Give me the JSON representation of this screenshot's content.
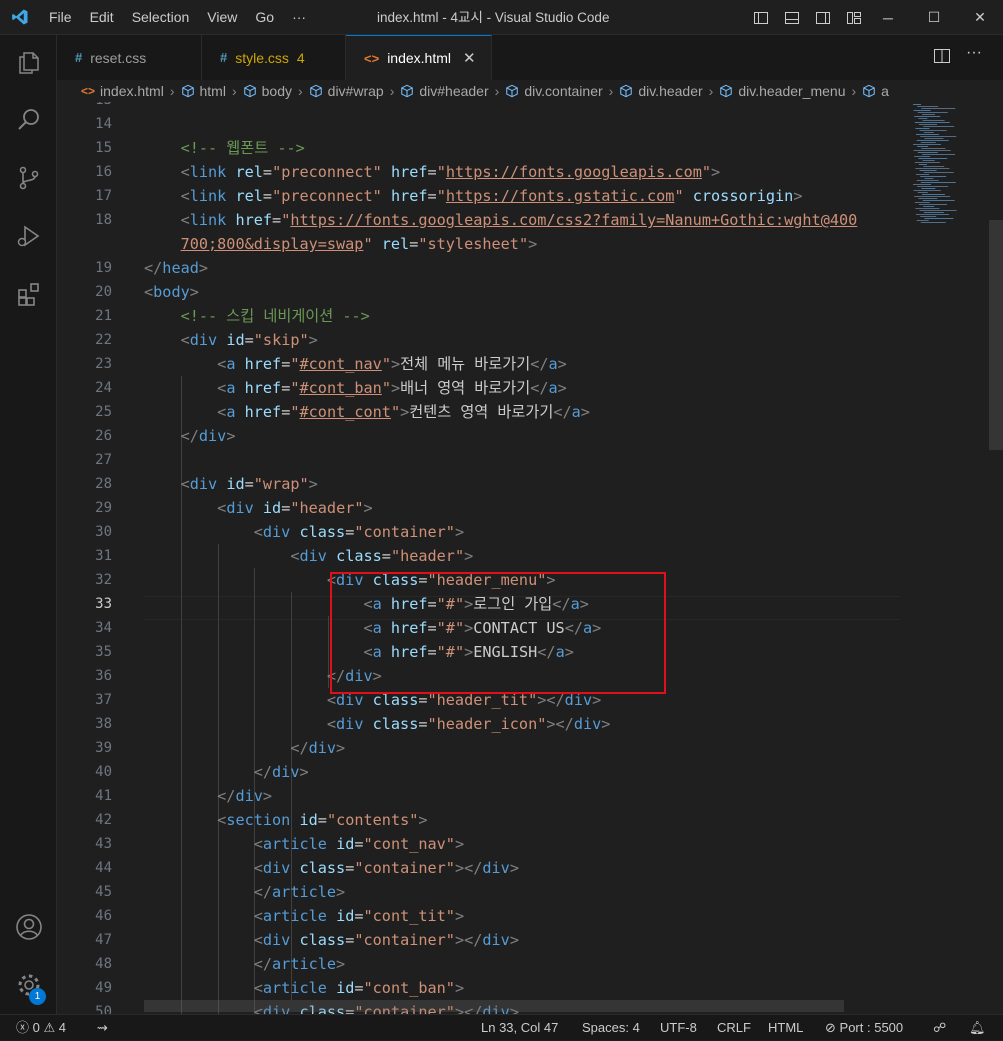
{
  "titlebar": {
    "menu": [
      "File",
      "Edit",
      "Selection",
      "View",
      "Go",
      "···"
    ],
    "title": "index.html - 4교시 - Visual Studio Code"
  },
  "tabs": [
    {
      "label": "reset.css",
      "icon": "css-hash-icon",
      "modified_count": ""
    },
    {
      "label": "style.css",
      "icon": "css-hash-icon",
      "modified_count": "4"
    },
    {
      "label": "index.html",
      "icon": "html-icon",
      "modified_count": ""
    }
  ],
  "breadcrumb": [
    "index.html",
    "html",
    "body",
    "div#wrap",
    "div#header",
    "div.container",
    "div.header",
    "div.header_menu",
    "a"
  ],
  "editor": {
    "current_line": 33,
    "lines": [
      {
        "n": "13",
        "html": ""
      },
      {
        "n": "14",
        "html": ""
      },
      {
        "n": "15",
        "html": "    <span class=\"c\">&lt;!-- 웹폰트 --&gt;</span>"
      },
      {
        "n": "16",
        "html": "    <span class=\"p\">&lt;</span><span class=\"t\">link</span> <span class=\"a\">rel</span><span class=\"w\">=</span><span class=\"s\">\"preconnect\"</span> <span class=\"a\">href</span><span class=\"w\">=</span><span class=\"s\">\"<span class=\"u\">https://fonts.googleapis.com</span>\"</span><span class=\"p\">&gt;</span>"
      },
      {
        "n": "17",
        "html": "    <span class=\"p\">&lt;</span><span class=\"t\">link</span> <span class=\"a\">rel</span><span class=\"w\">=</span><span class=\"s\">\"preconnect\"</span> <span class=\"a\">href</span><span class=\"w\">=</span><span class=\"s\">\"<span class=\"u\">https://fonts.gstatic.com</span>\"</span> <span class=\"a\">crossorigin</span><span class=\"p\">&gt;</span>"
      },
      {
        "n": "18",
        "html": "    <span class=\"p\">&lt;</span><span class=\"t\">link</span> <span class=\"a\">href</span><span class=\"w\">=</span><span class=\"s\">\"<span class=\"u\">https://fonts.googleapis.com/css2?family=Nanum+Gothic:wght@400</span></span>"
      },
      {
        "n": "",
        "html": "    <span class=\"s\"><span class=\"u\">700;800&amp;display=swap</span>\"</span> <span class=\"a\">rel</span><span class=\"w\">=</span><span class=\"s\">\"stylesheet\"</span><span class=\"p\">&gt;</span>"
      },
      {
        "n": "19",
        "html": "<span class=\"p\">&lt;/</span><span class=\"t\">head</span><span class=\"p\">&gt;</span>"
      },
      {
        "n": "20",
        "html": "<span class=\"p\">&lt;</span><span class=\"t\">body</span><span class=\"p\">&gt;</span>"
      },
      {
        "n": "21",
        "html": "    <span class=\"c\">&lt;!-- 스킵 네비게이션 --&gt;</span>"
      },
      {
        "n": "22",
        "html": "    <span class=\"p\">&lt;</span><span class=\"t\">div</span> <span class=\"a\">id</span><span class=\"w\">=</span><span class=\"s\">\"skip\"</span><span class=\"p\">&gt;</span>"
      },
      {
        "n": "23",
        "html": "        <span class=\"p\">&lt;</span><span class=\"t\">a</span> <span class=\"a\">href</span><span class=\"w\">=</span><span class=\"s\">\"<span class=\"u\">#cont_nav</span>\"</span><span class=\"p\">&gt;</span>전체 메뉴 바로가기<span class=\"p\">&lt;/</span><span class=\"t\">a</span><span class=\"p\">&gt;</span>"
      },
      {
        "n": "24",
        "html": "        <span class=\"p\">&lt;</span><span class=\"t\">a</span> <span class=\"a\">href</span><span class=\"w\">=</span><span class=\"s\">\"<span class=\"u\">#cont_ban</span>\"</span><span class=\"p\">&gt;</span>배너 영역 바로가기<span class=\"p\">&lt;/</span><span class=\"t\">a</span><span class=\"p\">&gt;</span>"
      },
      {
        "n": "25",
        "html": "        <span class=\"p\">&lt;</span><span class=\"t\">a</span> <span class=\"a\">href</span><span class=\"w\">=</span><span class=\"s\">\"<span class=\"u\">#cont_cont</span>\"</span><span class=\"p\">&gt;</span>컨텐츠 영역 바로가기<span class=\"p\">&lt;/</span><span class=\"t\">a</span><span class=\"p\">&gt;</span>"
      },
      {
        "n": "26",
        "html": "    <span class=\"p\">&lt;/</span><span class=\"t\">div</span><span class=\"p\">&gt;</span>"
      },
      {
        "n": "27",
        "html": ""
      },
      {
        "n": "28",
        "html": "    <span class=\"p\">&lt;</span><span class=\"t\">div</span> <span class=\"a\">id</span><span class=\"w\">=</span><span class=\"s\">\"wrap\"</span><span class=\"p\">&gt;</span>"
      },
      {
        "n": "29",
        "html": "        <span class=\"p\">&lt;</span><span class=\"t\">div</span> <span class=\"a\">id</span><span class=\"w\">=</span><span class=\"s\">\"header\"</span><span class=\"p\">&gt;</span>"
      },
      {
        "n": "30",
        "html": "            <span class=\"p\">&lt;</span><span class=\"t\">div</span> <span class=\"a\">class</span><span class=\"w\">=</span><span class=\"s\">\"container\"</span><span class=\"p\">&gt;</span>"
      },
      {
        "n": "31",
        "html": "                <span class=\"p\">&lt;</span><span class=\"t\">div</span> <span class=\"a\">class</span><span class=\"w\">=</span><span class=\"s\">\"header\"</span><span class=\"p\">&gt;</span>"
      },
      {
        "n": "32",
        "html": "                    <span class=\"p\">&lt;</span><span class=\"t\">div</span> <span class=\"a\">class</span><span class=\"w\">=</span><span class=\"s\">\"header_menu\"</span><span class=\"p\">&gt;</span>"
      },
      {
        "n": "33",
        "html": "                        <span class=\"p\">&lt;</span><span class=\"t\">a</span> <span class=\"a\">href</span><span class=\"w\">=</span><span class=\"s\">\"#\"</span><span class=\"p\">&gt;</span>로그인 가입<span class=\"p\">&lt;/</span><span class=\"t\">a</span><span class=\"p\">&gt;</span>"
      },
      {
        "n": "34",
        "html": "                        <span class=\"p\">&lt;</span><span class=\"t\">a</span> <span class=\"a\">href</span><span class=\"w\">=</span><span class=\"s\">\"#\"</span><span class=\"p\">&gt;</span>CONTACT US<span class=\"p\">&lt;/</span><span class=\"t\">a</span><span class=\"p\">&gt;</span>"
      },
      {
        "n": "35",
        "html": "                        <span class=\"p\">&lt;</span><span class=\"t\">a</span> <span class=\"a\">href</span><span class=\"w\">=</span><span class=\"s\">\"#\"</span><span class=\"p\">&gt;</span>ENGLISH<span class=\"p\">&lt;/</span><span class=\"t\">a</span><span class=\"p\">&gt;</span>"
      },
      {
        "n": "36",
        "html": "                    <span class=\"p\">&lt;/</span><span class=\"t\">div</span><span class=\"p\">&gt;</span>"
      },
      {
        "n": "37",
        "html": "                    <span class=\"p\">&lt;</span><span class=\"t\">div</span> <span class=\"a\">class</span><span class=\"w\">=</span><span class=\"s\">\"header_tit\"</span><span class=\"p\">&gt;&lt;/</span><span class=\"t\">div</span><span class=\"p\">&gt;</span>"
      },
      {
        "n": "38",
        "html": "                    <span class=\"p\">&lt;</span><span class=\"t\">div</span> <span class=\"a\">class</span><span class=\"w\">=</span><span class=\"s\">\"header_icon\"</span><span class=\"p\">&gt;&lt;/</span><span class=\"t\">div</span><span class=\"p\">&gt;</span>"
      },
      {
        "n": "39",
        "html": "                <span class=\"p\">&lt;/</span><span class=\"t\">div</span><span class=\"p\">&gt;</span>"
      },
      {
        "n": "40",
        "html": "            <span class=\"p\">&lt;/</span><span class=\"t\">div</span><span class=\"p\">&gt;</span>"
      },
      {
        "n": "41",
        "html": "        <span class=\"p\">&lt;/</span><span class=\"t\">div</span><span class=\"p\">&gt;</span>"
      },
      {
        "n": "42",
        "html": "        <span class=\"p\">&lt;</span><span class=\"t\">section</span> <span class=\"a\">id</span><span class=\"w\">=</span><span class=\"s\">\"contents\"</span><span class=\"p\">&gt;</span>"
      },
      {
        "n": "43",
        "html": "            <span class=\"p\">&lt;</span><span class=\"t\">article</span> <span class=\"a\">id</span><span class=\"w\">=</span><span class=\"s\">\"cont_nav\"</span><span class=\"p\">&gt;</span>"
      },
      {
        "n": "44",
        "html": "            <span class=\"p\">&lt;</span><span class=\"t\">div</span> <span class=\"a\">class</span><span class=\"w\">=</span><span class=\"s\">\"container\"</span><span class=\"p\">&gt;&lt;/</span><span class=\"t\">div</span><span class=\"p\">&gt;</span>"
      },
      {
        "n": "45",
        "html": "            <span class=\"p\">&lt;/</span><span class=\"t\">article</span><span class=\"p\">&gt;</span>"
      },
      {
        "n": "46",
        "html": "            <span class=\"p\">&lt;</span><span class=\"t\">article</span> <span class=\"a\">id</span><span class=\"w\">=</span><span class=\"s\">\"cont_tit\"</span><span class=\"p\">&gt;</span>"
      },
      {
        "n": "47",
        "html": "            <span class=\"p\">&lt;</span><span class=\"t\">div</span> <span class=\"a\">class</span><span class=\"w\">=</span><span class=\"s\">\"container\"</span><span class=\"p\">&gt;&lt;/</span><span class=\"t\">div</span><span class=\"p\">&gt;</span>"
      },
      {
        "n": "48",
        "html": "            <span class=\"p\">&lt;/</span><span class=\"t\">article</span><span class=\"p\">&gt;</span>"
      },
      {
        "n": "49",
        "html": "            <span class=\"p\">&lt;</span><span class=\"t\">article</span> <span class=\"a\">id</span><span class=\"w\">=</span><span class=\"s\">\"cont_ban\"</span><span class=\"p\">&gt;</span>"
      },
      {
        "n": "50",
        "html": "            <span class=\"p\">&lt;</span><span class=\"t\">div</span> <span class=\"a\">class</span><span class=\"w\">=</span><span class=\"s\">\"container\"</span><span class=\"p\">&gt;&lt;/</span><span class=\"t\">div</span><span class=\"p\">&gt;</span>"
      }
    ]
  },
  "statusbar": {
    "errors": "0",
    "warnings": "4",
    "position": "Ln 33, Col 47",
    "spaces": "Spaces: 4",
    "encoding": "UTF-8",
    "eol": "CRLF",
    "language": "HTML",
    "port": "Port : 5500"
  },
  "accounts_badge": "1",
  "colors": {
    "accent": "#0078d4",
    "highlight_box": "#e0101b"
  }
}
